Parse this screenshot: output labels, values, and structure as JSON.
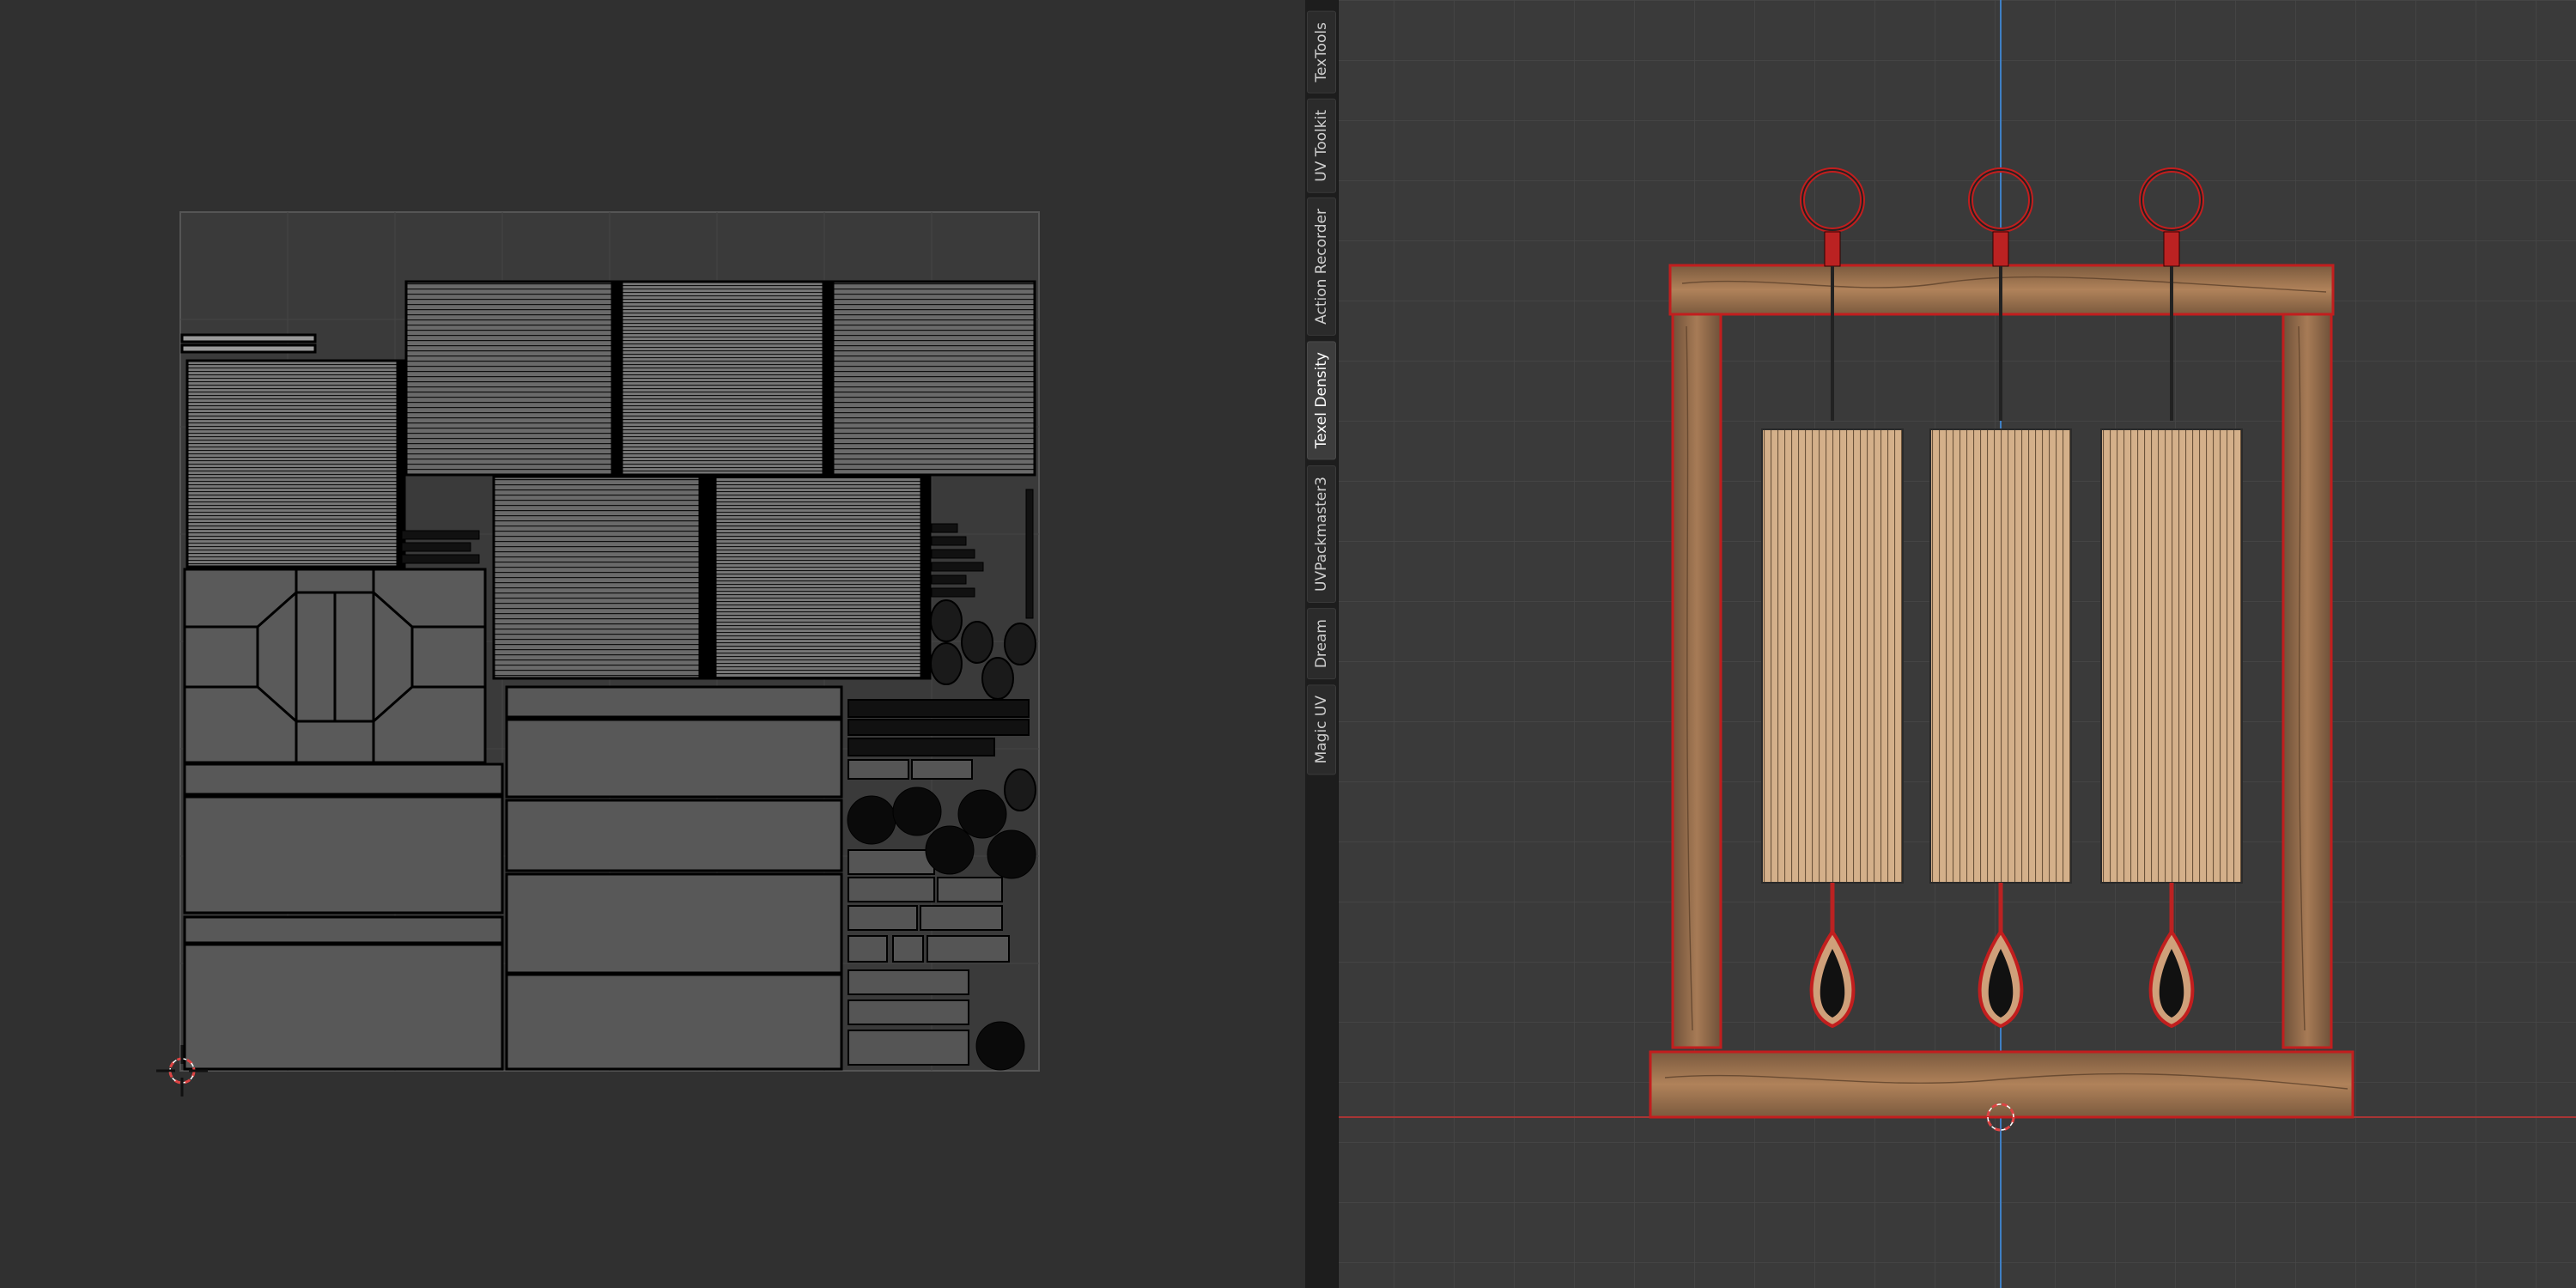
{
  "uv_editor": {
    "background_color": "#303030",
    "tile_color": "#3b3b3b",
    "island_fill": "#5b5b5b",
    "island_edge": "#000000",
    "icons": [
      "cursor-icon"
    ]
  },
  "sidebar": {
    "tabs": [
      {
        "label": "TexTools",
        "active": false
      },
      {
        "label": "UV Toolkit",
        "active": false
      },
      {
        "label": "Action Recorder",
        "active": false
      },
      {
        "label": "Texel Density",
        "active": true
      },
      {
        "label": "UVPackmaster3",
        "active": false
      },
      {
        "label": "Dream",
        "active": false
      },
      {
        "label": "Magic UV",
        "active": false
      }
    ]
  },
  "viewport": {
    "background_color": "#3a3a3a",
    "grid_color": "#464646",
    "x_axis_color": "#b23a3a",
    "z_axis_color": "#3f7fc4",
    "wood_color": "#a87a52",
    "tube_color": "#d6b48e",
    "selection_color": "#d02020",
    "icons": [
      "cursor-icon"
    ]
  }
}
